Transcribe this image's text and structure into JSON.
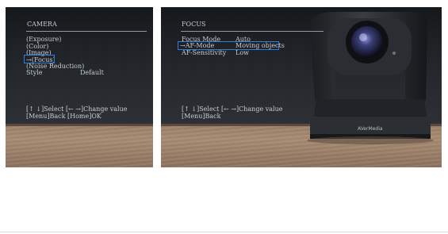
{
  "left_panel": {
    "title": "CAMERA",
    "menu": [
      "(Exposure)",
      "(Color)",
      "(Image)",
      "→(Focus)",
      "(Noise Reduction)"
    ],
    "style_label": "Style",
    "style_value": "Default",
    "help_line1": "[↑ ↓]Select [← →]Change value",
    "help_line2": "[Menu]Back  [Home]OK",
    "highlight_color": "#2f7fd9"
  },
  "right_panel": {
    "title": "FOCUS",
    "rows": [
      {
        "label": "Focus Mode",
        "value": "Auto"
      },
      {
        "label": "→AF-Mode",
        "value": "Moving objects"
      },
      {
        "label": "AF-Sensitivity",
        "value": "Low"
      }
    ],
    "help_line1": "[↑ ↓]Select [← →]Change value",
    "help_line2": "[Menu]Back",
    "camera_brand": "AVerMedia"
  }
}
